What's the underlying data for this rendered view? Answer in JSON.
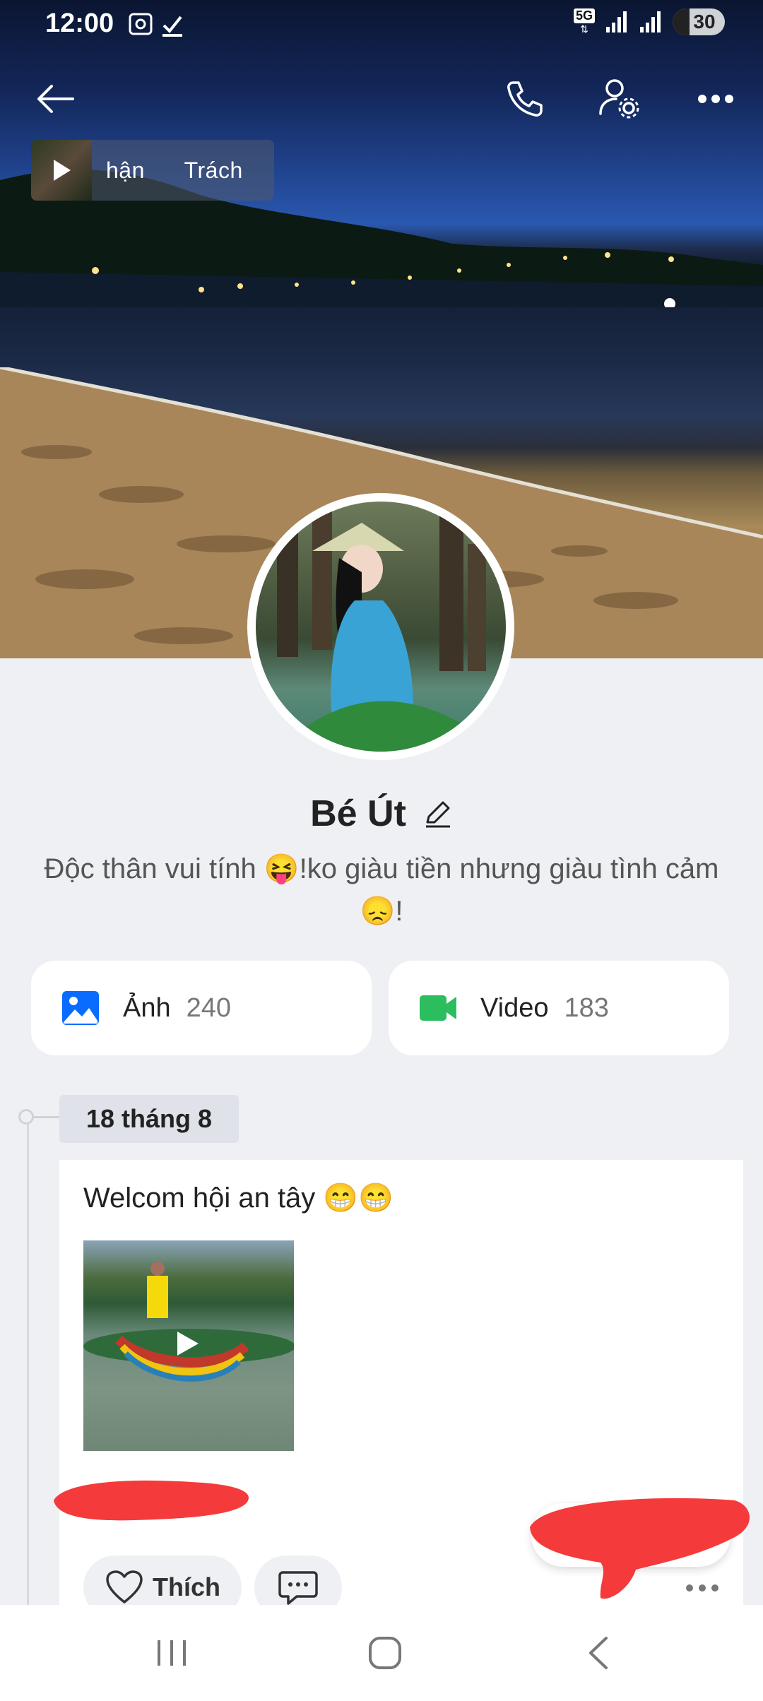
{
  "status_bar": {
    "time": "12:00",
    "network": "5G",
    "battery": "30"
  },
  "music": {
    "label": "hận      Trách"
  },
  "profile": {
    "name": "Bé Út",
    "bio": "Độc thân vui tính 😝!ko giàu tiền nhưng giàu tình cảm 😞!"
  },
  "media": {
    "photos_label": "Ảnh",
    "photos_count": "240",
    "videos_label": "Video",
    "videos_count": "183"
  },
  "timeline": {
    "date": "18 tháng 8",
    "post_text": "Welcom hội an tây 😁😁",
    "like_label": "Thích"
  },
  "colors": {
    "accent": "#0068ff",
    "video_green": "#2bbd5e",
    "redaction": "#f43a3a"
  }
}
